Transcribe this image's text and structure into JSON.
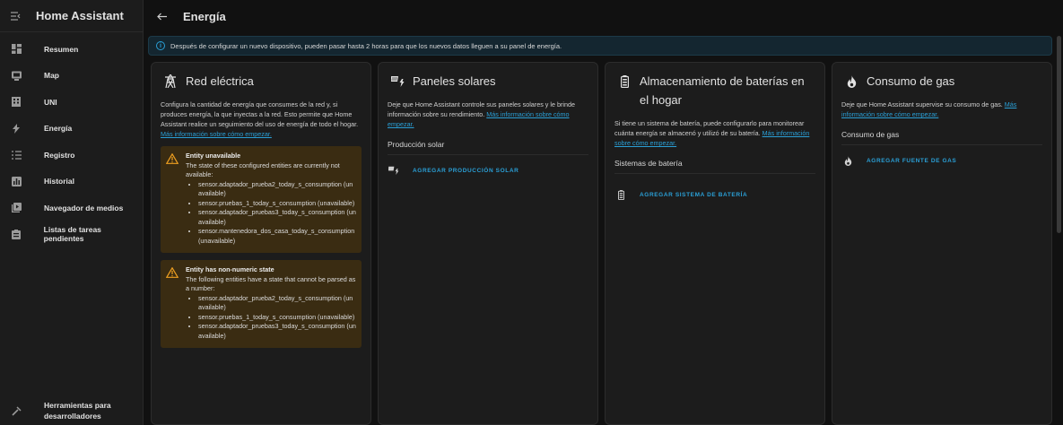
{
  "app": {
    "title": "Home Assistant"
  },
  "page": {
    "title": "Energía"
  },
  "sidebar": {
    "items": [
      {
        "label": "Resumen",
        "icon": "dashboard-icon"
      },
      {
        "label": "Map",
        "icon": "map-icon"
      },
      {
        "label": "UNI",
        "icon": "building-icon"
      },
      {
        "label": "Energía",
        "icon": "lightning-icon"
      },
      {
        "label": "Registro",
        "icon": "list-icon"
      },
      {
        "label": "Historial",
        "icon": "chart-icon"
      },
      {
        "label": "Navegador de medios",
        "icon": "media-icon"
      },
      {
        "label": "Listas de tareas pendientes",
        "icon": "checklist-icon"
      }
    ],
    "bottom": {
      "label": "Herramientas para desarrolladores",
      "icon": "hammer-icon"
    }
  },
  "banner": {
    "text": "Después de configurar un nuevo dispositivo, pueden pasar hasta 2 horas para que los nuevos datos lleguen a su panel de energía."
  },
  "cards": {
    "grid": {
      "title": "Red eléctrica",
      "desc": "Configura la cantidad de energía que consumes de la red y, si produces energía, la que inyectas a la red. Esto permite que Home Assistant realice un seguimiento del uso de energía de todo el hogar.",
      "link": "Más información sobre cómo empezar.",
      "warnings": [
        {
          "title": "Entity unavailable",
          "text": "The state of these configured entities are currently not available:",
          "items": [
            "sensor.adaptador_prueba2_today_s_consumption (unavailable)",
            "sensor.pruebas_1_today_s_consumption (unavailable)",
            "sensor.adaptador_pruebas3_today_s_consumption (unavailable)",
            "sensor.mantenedora_dos_casa_today_s_consumption (unavailable)"
          ]
        },
        {
          "title": "Entity has non-numeric state",
          "text": "The following entities have a state that cannot be parsed as a number:",
          "items": [
            "sensor.adaptador_prueba2_today_s_consumption (unavailable)",
            "sensor.pruebas_1_today_s_consumption (unavailable)",
            "sensor.adaptador_pruebas3_today_s_consumption (unavailable)"
          ]
        }
      ]
    },
    "solar": {
      "title": "Paneles solares",
      "desc": "Deje que Home Assistant controle sus paneles solares y le brinde información sobre su rendimiento.",
      "link": "Más información sobre cómo empezar.",
      "section": "Producción solar",
      "add": "Agregar producción solar"
    },
    "battery": {
      "title": "Almacenamiento de baterías en el hogar",
      "desc": "Si tiene un sistema de batería, puede configurarlo para monitorear cuánta energía se almacenó y utilizó de su batería.",
      "link": "Más información sobre cómo empezar.",
      "section": "Sistemas de batería",
      "add": "Agregar sistema de batería"
    },
    "gas": {
      "title": "Consumo de gas",
      "desc": "Deje que Home Assistant supervise su consumo de gas.",
      "link": "Más información sobre cómo empezar.",
      "section": "Consumo de gas",
      "add": "Agregar fuente de gas"
    }
  },
  "colors": {
    "accent": "#2a9fd6",
    "warning": "#f0a020",
    "warning_bg": "#3a2c12",
    "card_bg": "#1c1c1c",
    "page_bg": "#111111"
  }
}
